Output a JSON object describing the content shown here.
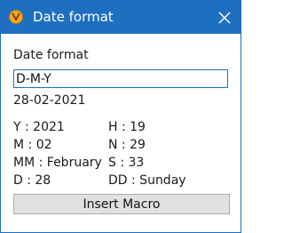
{
  "window": {
    "title": "Date format",
    "icon": "app-icon",
    "close_icon": "close-icon",
    "titlebar_color": "#1f6fc0"
  },
  "form": {
    "label": "Date format",
    "format_value": "D-M-Y",
    "result": "28-02-2021"
  },
  "tokens": {
    "left": [
      "Y : 2021",
      "M : 02",
      "MM : February",
      "D : 28"
    ],
    "right": [
      "H : 19",
      "N : 29",
      "S : 33",
      "DD : Sunday"
    ]
  },
  "button": {
    "label": "Insert Macro"
  }
}
